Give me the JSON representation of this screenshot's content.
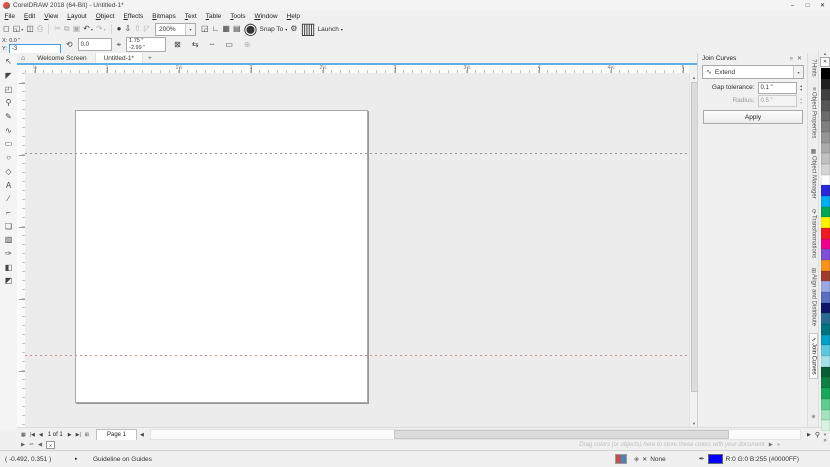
{
  "window": {
    "title": "CorelDRAW 2018 (64-Bit) - Untitled-1*",
    "minimize": "–",
    "maximize": "□",
    "close": "✕"
  },
  "menu": [
    "File",
    "Edit",
    "View",
    "Layout",
    "Object",
    "Effects",
    "Bitmaps",
    "Text",
    "Table",
    "Tools",
    "Window",
    "Help"
  ],
  "toolbar": {
    "left_icons": [
      {
        "name": "new-document-button",
        "glyph": "◻"
      },
      {
        "name": "open-button",
        "glyph": "◱",
        "dropdown": true
      },
      {
        "name": "save-button",
        "glyph": "◫"
      },
      {
        "name": "print-button",
        "glyph": "⎙",
        "disabled": true
      },
      {
        "name": "toolbar-separator",
        "sep": true
      },
      {
        "name": "cut-button",
        "glyph": "✂",
        "disabled": true
      },
      {
        "name": "copy-button",
        "glyph": "⧉",
        "disabled": true
      },
      {
        "name": "paste-button",
        "glyph": "▣",
        "disabled": true
      },
      {
        "name": "undo-button",
        "glyph": "↶",
        "dropdown": true
      },
      {
        "name": "redo-button",
        "glyph": "↷",
        "dropdown": true,
        "disabled": true
      },
      {
        "name": "toolbar-separator",
        "sep": true
      },
      {
        "name": "search-content-button",
        "glyph": "●"
      },
      {
        "name": "import-button",
        "glyph": "⇩"
      },
      {
        "name": "export-button",
        "glyph": "⇧",
        "disabled": true
      },
      {
        "name": "scale-ratio-icon",
        "glyph": "◸",
        "disabled": true
      }
    ],
    "zoom_value": "200%",
    "right_icons": [
      {
        "name": "full-screen-preview-button",
        "glyph": "◲"
      },
      {
        "name": "show-rulers-button",
        "glyph": "∟"
      },
      {
        "name": "show-grid-button",
        "glyph": "▦"
      },
      {
        "name": "show-guidelines-button",
        "glyph": "▤"
      }
    ],
    "snap_glyph": "◉",
    "snap_label": "Snap To",
    "options_glyph": "⚙",
    "launch_glyph": "▥",
    "launch_label": "Launch",
    "caret": "▾"
  },
  "property_bar": {
    "x_label": "X:",
    "x_value": "0.0 \"",
    "y_label": "Y:",
    "y_value": "-3",
    "angle_glyph": "⟲",
    "angle_value": "0.0",
    "center_glyph": "⌖",
    "center_x": "1.75 \"",
    "center_y": "-2.99 \"",
    "icons": [
      {
        "name": "lock-guideline-button",
        "glyph": "⊠"
      },
      {
        "name": "mirror-guidelines-button",
        "glyph": "⇆"
      },
      {
        "name": "guideline-style-button",
        "glyph": "┄"
      },
      {
        "name": "preset-guidelines-button",
        "glyph": "▭"
      },
      {
        "name": "add-guideline-button",
        "glyph": "⊕",
        "disabled": true
      }
    ]
  },
  "doc_tabs": {
    "home_glyph": "⌂",
    "items": [
      {
        "label": "Welcome Screen"
      },
      {
        "label": "Untitled-1*",
        "active": true
      }
    ],
    "new_tab_glyph": "+"
  },
  "ruler_labels": [
    "½",
    "1",
    "1½",
    "2",
    "2½",
    "3",
    "3½",
    "4",
    "4½",
    "5"
  ],
  "toolbox": [
    {
      "name": "pick-tool",
      "glyph": "↖"
    },
    {
      "name": "shape-tool",
      "glyph": "◤"
    },
    {
      "name": "crop-tool",
      "glyph": "◰"
    },
    {
      "name": "zoom-tool",
      "glyph": "⚲"
    },
    {
      "name": "freehand-tool",
      "glyph": "✎"
    },
    {
      "name": "artistic-media-tool",
      "glyph": "∿"
    },
    {
      "name": "rectangle-tool",
      "glyph": "▭"
    },
    {
      "name": "ellipse-tool",
      "glyph": "○"
    },
    {
      "name": "polygon-tool",
      "glyph": "◇"
    },
    {
      "name": "text-tool",
      "glyph": "A"
    },
    {
      "name": "dimension-tool",
      "glyph": "∕"
    },
    {
      "name": "connector-tool",
      "glyph": "⌐"
    },
    {
      "name": "drop-shadow-tool",
      "glyph": "❏"
    },
    {
      "name": "transparency-tool",
      "glyph": "▨"
    },
    {
      "name": "color-eyedropper-tool",
      "glyph": "✑"
    },
    {
      "name": "interactive-fill-tool",
      "glyph": "◧"
    },
    {
      "name": "smart-fill-tool",
      "glyph": "◩"
    }
  ],
  "docker": {
    "title": "Join Curves",
    "flyout_glyph": "»",
    "close_glyph": "✕",
    "mode_glyph": "∿",
    "mode": "Extend",
    "caret": "▾",
    "gap_label": "Gap tolerance:",
    "gap_value": "0.1 \"",
    "radius_label": "Radius:",
    "radius_value": "0.5 \"",
    "apply_label": "Apply"
  },
  "side_tabs": [
    {
      "name": "docker-tab-hints",
      "label": "Hints",
      "glyph": "?"
    },
    {
      "name": "docker-tab-object-properties",
      "label": "Object Properties",
      "glyph": "≡"
    },
    {
      "name": "docker-tab-object-manager",
      "label": "Object Manager",
      "glyph": "▦"
    },
    {
      "name": "docker-tab-transformations",
      "label": "Transformations",
      "glyph": "⟳"
    },
    {
      "name": "docker-tab-align-distribute",
      "label": "Align and Distribute",
      "glyph": "⊞"
    },
    {
      "name": "docker-tab-join-curves",
      "label": "Join Curves",
      "glyph": "∿",
      "active": true
    }
  ],
  "side_tabs_bottom": [
    {
      "name": "quick-customize-button",
      "glyph": "⊕"
    },
    {
      "name": "collapse-dockers-button",
      "glyph": "⌄"
    }
  ],
  "palette": {
    "up_glyph": "▲",
    "no_color_glyph": "✕",
    "down_glyph": "▼",
    "flyout_glyph": "»",
    "colors": [
      "#000000",
      "#202020",
      "#404040",
      "#565656",
      "#6b6b6b",
      "#808080",
      "#959595",
      "#ababab",
      "#c0c0c0",
      "#d5d5d5",
      "#ffffff",
      "#2929d6",
      "#00adef",
      "#00a651",
      "#fff200",
      "#ed1c24",
      "#ec008c",
      "#7f4fd8",
      "#f7941d",
      "#a03c2e",
      "#9ba7e0",
      "#5b6fc0",
      "#0f1866",
      "#2a6b8f",
      "#00737d",
      "#009fc5",
      "#5fc7dd",
      "#a8e0ea",
      "#0b5d36",
      "#0e8044",
      "#18a85a",
      "#62cb8e",
      "#a5e3c0",
      "#d8f2e2"
    ]
  },
  "page_nav": {
    "sorter_glyph": "▦",
    "first_glyph": "|◀",
    "prev_glyph": "◀",
    "counter": "1 of 1",
    "next_glyph": "▶",
    "last_glyph": "▶|",
    "add_glyph": "⊞",
    "page_tab": "Page 1",
    "scroll_left": "◀",
    "scroll_right": "▶",
    "zoom_glyph": "⚲"
  },
  "doc_palette": {
    "flyout_glyph": "▶",
    "eyedropper_glyph": "✑",
    "left_glyph": "◀",
    "no_color_glyph": "✕",
    "hint": "Drag colors (or objects) here to store these colors with your document",
    "right_glyph": "▶",
    "more_glyph": "»"
  },
  "status": {
    "coords": "( -0.492, 0.351 )",
    "expand_glyph": "▸",
    "message": "Guideline on Guides",
    "fill_glyph": "◈",
    "fill_x": "✕",
    "fill_label": "None",
    "pen_glyph": "✒",
    "outline_color": "#0000ff",
    "outline_value": "R:0 G:0 B:255 (#0000FF)"
  }
}
